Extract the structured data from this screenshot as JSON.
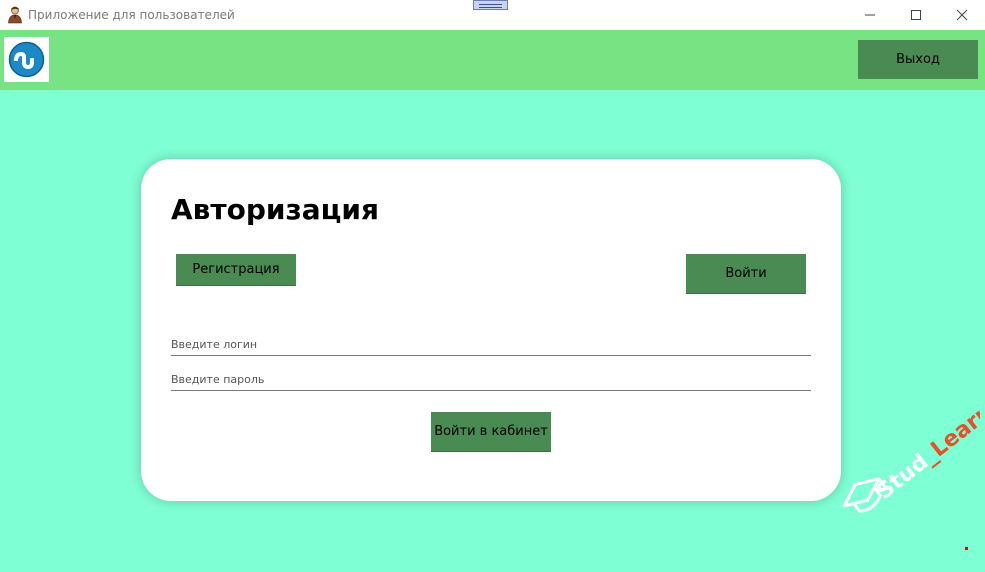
{
  "window": {
    "title": "Приложение для пользователей",
    "controls": {
      "minimize_icon": "minimize-icon",
      "maximize_icon": "maximize-icon",
      "close_icon": "close-icon"
    }
  },
  "header": {
    "logo_icon": "stumbleupon-logo-icon",
    "exit_label": "Выход"
  },
  "auth": {
    "title": "Авторизация",
    "register_label": "Регистрация",
    "login_label": "Войти",
    "login_placeholder": "Введите логин",
    "password_placeholder": "Введите пароль",
    "login_value": "",
    "password_value": "",
    "cabinet_label": "Войти в кабинет"
  },
  "watermark": {
    "brand": "StudLearn",
    "text_part1": "Stud",
    "text_part2": "_Learn"
  },
  "colors": {
    "background": "#7fffd4",
    "header": "#77e383",
    "button": "#4a8a53",
    "card": "#ffffff",
    "watermark_accent": "#e8502a"
  }
}
